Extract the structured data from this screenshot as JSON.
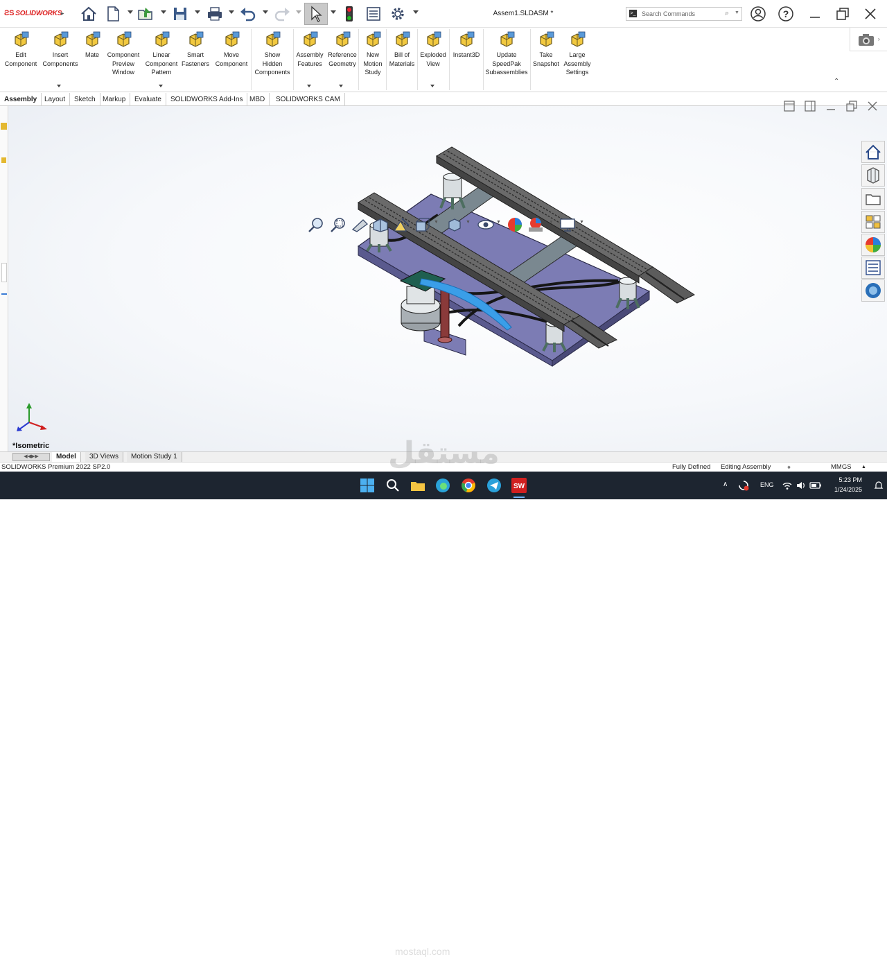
{
  "app": {
    "logo_text": "SOLIDWORKS",
    "document_title": "Assem1.SLDASM *",
    "search_placeholder": "Search Commands"
  },
  "ribbon": {
    "buttons": [
      {
        "label": "Edit\nComponent",
        "icon": "edit-component-icon"
      },
      {
        "label": "Insert\nComponents",
        "icon": "insert-components-icon"
      },
      {
        "label": "Mate",
        "icon": "mate-icon"
      },
      {
        "label": "Component\nPreview\nWindow",
        "icon": "component-preview-icon"
      },
      {
        "label": "Linear\nComponent\nPattern",
        "icon": "linear-pattern-icon"
      },
      {
        "label": "Smart\nFasteners",
        "icon": "smart-fasteners-icon"
      },
      {
        "label": "Move\nComponent",
        "icon": "move-component-icon"
      },
      {
        "label": "Show\nHidden\nComponents",
        "icon": "show-hidden-icon"
      },
      {
        "label": "Assembly\nFeatures",
        "icon": "assembly-features-icon"
      },
      {
        "label": "Reference\nGeometry",
        "icon": "reference-geometry-icon"
      },
      {
        "label": "New\nMotion\nStudy",
        "icon": "motion-study-icon"
      },
      {
        "label": "Bill of\nMaterials",
        "icon": "bom-icon"
      },
      {
        "label": "Exploded\nView",
        "icon": "exploded-view-icon"
      },
      {
        "label": "Instant3D",
        "icon": "instant3d-icon"
      },
      {
        "label": "Update\nSpeedPak\nSubassemblies",
        "icon": "speedpak-icon"
      },
      {
        "label": "Take\nSnapshot",
        "icon": "snapshot-icon"
      },
      {
        "label": "Large\nAssembly\nSettings",
        "icon": "large-assembly-icon"
      }
    ]
  },
  "tabs": [
    {
      "label": "Assembly",
      "active": true
    },
    {
      "label": "Layout"
    },
    {
      "label": "Sketch"
    },
    {
      "label": "Markup"
    },
    {
      "label": "Evaluate"
    },
    {
      "label": "SOLIDWORKS Add-Ins"
    },
    {
      "label": "MBD"
    },
    {
      "label": "SOLIDWORKS CAM"
    }
  ],
  "viewport": {
    "view_name": "*Isometric"
  },
  "bottom_tabs": [
    {
      "label": "Model",
      "active": true
    },
    {
      "label": "3D Views"
    },
    {
      "label": "Motion Study 1"
    }
  ],
  "status_bar": {
    "product": "SOLIDWORKS Premium 2022 SP2.0",
    "state": "Fully Defined",
    "mode": "Editing Assembly",
    "units": "MMGS"
  },
  "taskbar": {
    "language": "ENG",
    "time": "5:23 PM",
    "date": "1/24/2025"
  },
  "watermark": {
    "arabic": "مستقل",
    "latin": "mostaql.com"
  },
  "colors": {
    "brand": "#d22020",
    "platform": "#7a7ab0",
    "steel": "#6e7f86",
    "taskbar": "#1d2530"
  }
}
